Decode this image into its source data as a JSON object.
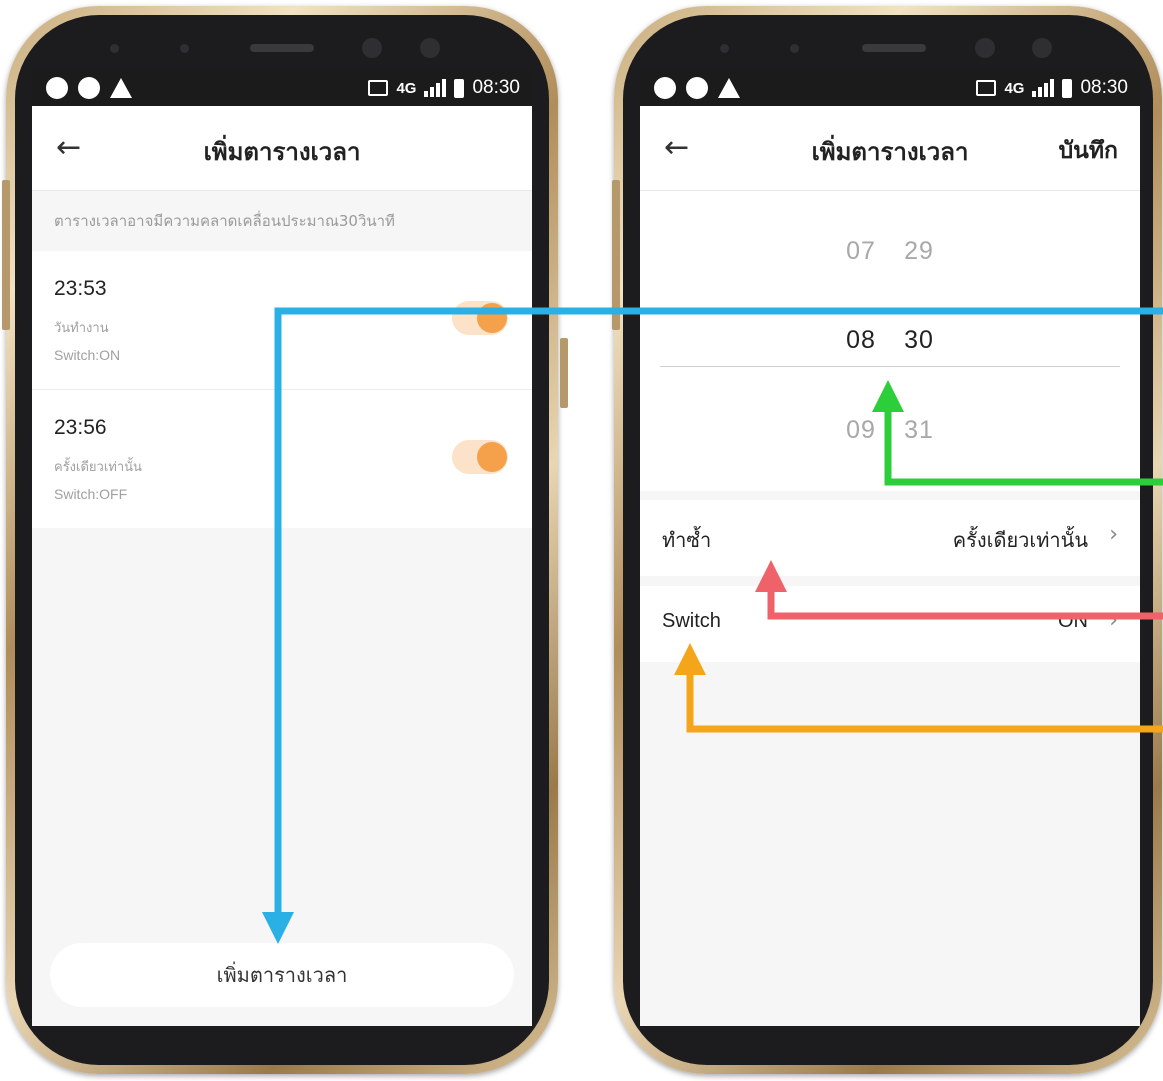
{
  "status_bar": {
    "time": "08:30",
    "network": "4G"
  },
  "schedule_list_screen": {
    "title": "เพิ่มตารางเวลา",
    "hint": "ตารางเวลาอาจมีความคลาดเคลื่อนประมาณ30วินาที",
    "schedules": [
      {
        "time": "23:53",
        "repeat": "วันทำงาน",
        "switch": "Switch:ON",
        "enabled": true
      },
      {
        "time": "23:56",
        "repeat": "ครั้งเดียวเท่านั้น",
        "switch": "Switch:OFF",
        "enabled": true
      }
    ],
    "add_button": "เพิ่มตารางเวลา"
  },
  "add_schedule_screen": {
    "title": "เพิ่มตารางเวลา",
    "save_label": "บันทึก",
    "picker": {
      "above": {
        "hour": "07",
        "minute": "29"
      },
      "selected": {
        "hour": "08",
        "minute": "30"
      },
      "below": {
        "hour": "09",
        "minute": "31"
      }
    },
    "repeat_row": {
      "label": "ทำซ้ำ",
      "value": "ครั้งเดียวเท่านั้น"
    },
    "switch_row": {
      "label": "Switch",
      "value": "ON"
    }
  },
  "icons": {
    "back": "arrow-left-icon",
    "chevron": "chevron-right-icon"
  },
  "colors": {
    "toggle_on": "#f5a04a",
    "arrow_blue": "#2bb0e6",
    "arrow_green": "#2ccf3a",
    "arrow_red": "#f0626a",
    "arrow_orange": "#f5a51a"
  }
}
